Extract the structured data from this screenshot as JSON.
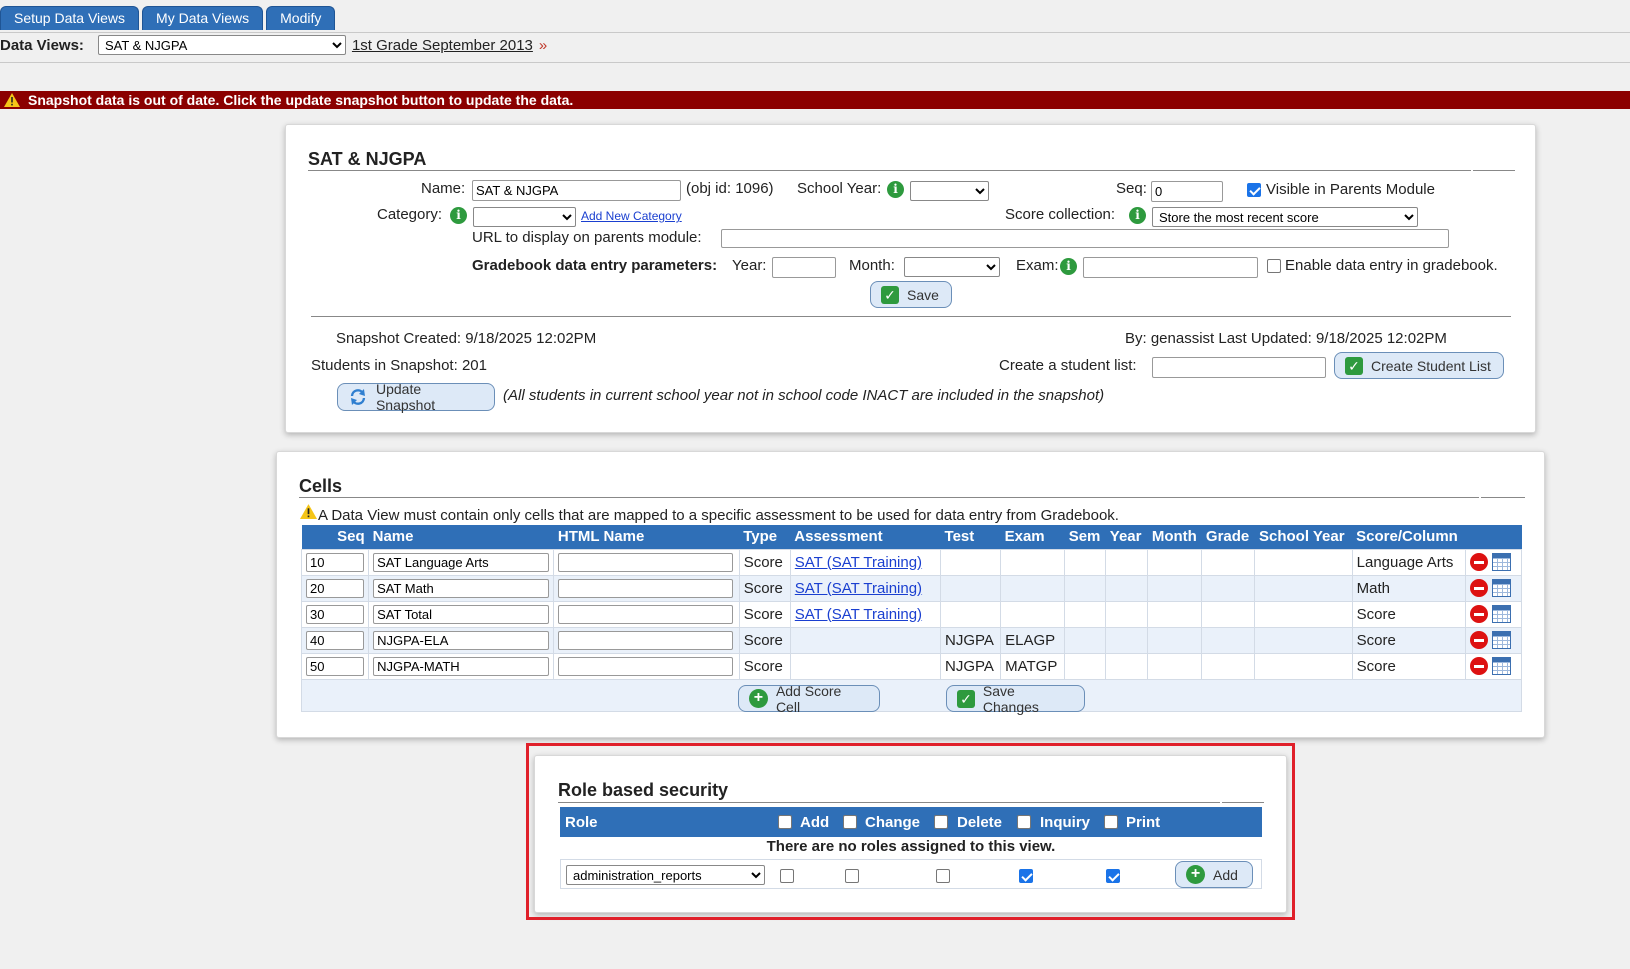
{
  "tabs": [
    "Setup Data Views",
    "My Data Views",
    "Modify"
  ],
  "data_views": {
    "label": "Data Views:",
    "selected": "SAT & NJGPA",
    "link": "1st Grade September 2013",
    "more": "»"
  },
  "alert": "Snapshot data is out of date. Click the update snapshot button to update the data.",
  "setup": {
    "title": "SAT & NJGPA",
    "name_label": "Name:",
    "name_value": "SAT & NJGPA",
    "obj_id": "(obj id: 1096)",
    "school_year_label": "School Year:",
    "school_year_value": "",
    "seq_label": "Seq:",
    "seq_value": "0",
    "visible_label": "Visible in Parents Module",
    "category_label": "Category:",
    "category_value": "",
    "add_category": "Add New Category",
    "score_collection_label": "Score collection:",
    "score_collection_value": "Store the most recent score",
    "url_label": "URL to display on parents module:",
    "url_value": "",
    "gb_label": "Gradebook data entry parameters:",
    "year_label": "Year:",
    "year_value": "",
    "month_label": "Month:",
    "month_value": "",
    "exam_label": "Exam:",
    "exam_value": "",
    "enable_label": "Enable data entry in gradebook.",
    "save": "Save",
    "snapshot_created": "Snapshot Created: 9/18/2025 12:02PM",
    "by_updated": "By: genassist Last Updated: 9/18/2025 12:02PM",
    "students": "Students in Snapshot: 201",
    "create_list_label": "Create a student list:",
    "create_list_value": "",
    "create_list_btn": "Create Student List",
    "update_btn": "Update Snapshot",
    "update_note": "(All students in current school year not in school code INACT are included in the snapshot)"
  },
  "cells": {
    "title": "Cells",
    "warning": "A Data View must contain only cells that are mapped to a specific assessment to be used for data entry from Gradebook.",
    "headers": [
      "Seq",
      "Name",
      "HTML Name",
      "Type",
      "Assessment",
      "Test",
      "Exam",
      "Sem",
      "Year",
      "Month",
      "Grade",
      "School Year",
      "Score/Column"
    ],
    "rows": [
      {
        "seq": "10",
        "name": "SAT Language Arts",
        "html": "",
        "type": "Score",
        "assessment": "SAT (SAT Training)",
        "test": "",
        "exam": "",
        "score": "Language Arts"
      },
      {
        "seq": "20",
        "name": "SAT Math",
        "html": "",
        "type": "Score",
        "assessment": "SAT (SAT Training)",
        "test": "",
        "exam": "",
        "score": "Math"
      },
      {
        "seq": "30",
        "name": "SAT Total",
        "html": "",
        "type": "Score",
        "assessment": "SAT (SAT Training)",
        "test": "",
        "exam": "",
        "score": "Score"
      },
      {
        "seq": "40",
        "name": "NJGPA-ELA",
        "html": "",
        "type": "Score",
        "assessment": "",
        "test": "NJGPA",
        "exam": "ELAGP",
        "score": "Score"
      },
      {
        "seq": "50",
        "name": "NJGPA-MATH",
        "html": "",
        "type": "Score",
        "assessment": "",
        "test": "NJGPA",
        "exam": "MATGP",
        "score": "Score"
      }
    ],
    "add_btn": "Add Score Cell",
    "save_btn": "Save Changes"
  },
  "security": {
    "title": "Role based security",
    "headers": {
      "role": "Role",
      "add": "Add",
      "change": "Change",
      "delete": "Delete",
      "inquiry": "Inquiry",
      "print": "Print"
    },
    "empty": "There are no roles assigned to this view.",
    "role_value": "administration_reports",
    "checks": {
      "add": false,
      "change": false,
      "delete": false,
      "inquiry": true,
      "print": true
    },
    "add_btn": "Add"
  },
  "colors": {
    "tab": "#2f6fb7",
    "alert": "#8b0000",
    "header": "#2f6fb7",
    "highlight": "#e0202a"
  }
}
